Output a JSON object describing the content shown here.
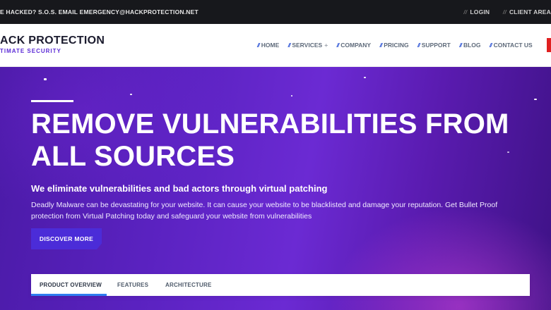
{
  "topbar": {
    "alert": "E HACKED? S.O.S. EMAIL EMERGENCY@HACKPROTECTION.NET",
    "links": [
      {
        "label": "LOGIN"
      },
      {
        "label": "CLIENT AREA"
      }
    ],
    "slash": "//"
  },
  "header": {
    "logo_name": "ACK PROTECTION",
    "logo_tagline": "TIMATE SECURITY",
    "nav": [
      {
        "label": "HOME"
      },
      {
        "label": "SERVICES",
        "has_plus": true
      },
      {
        "label": "COMPANY"
      },
      {
        "label": "PRICING"
      },
      {
        "label": "SUPPORT"
      },
      {
        "label": "BLOG"
      },
      {
        "label": "CONTACT US"
      }
    ],
    "nav_slash": "//",
    "plus": "+"
  },
  "hero": {
    "title": "REMOVE VULNERABILITIES FROM ALL SOURCES",
    "subtitle": "We eliminate vulnerabilities and bad actors through virtual patching",
    "description": "Deadly Malware can be devastating for your website. It can cause your website to be blacklisted and damage your reputation. Get Bullet Proof protection from Virtual Patching today and safeguard your website from vulnerabilities",
    "cta": "DISCOVER MORE"
  },
  "tabs": {
    "items": [
      {
        "label": "PRODUCT OVERVIEW",
        "active": true
      },
      {
        "label": "FEATURES",
        "active": false
      },
      {
        "label": "ARCHITECTURE",
        "active": false
      }
    ]
  },
  "colors": {
    "accent_blue": "#2f56d6",
    "button_purple": "#4b2cd8",
    "hero_purple": "#5a22c0",
    "tab_underline": "#2f7ef0"
  }
}
